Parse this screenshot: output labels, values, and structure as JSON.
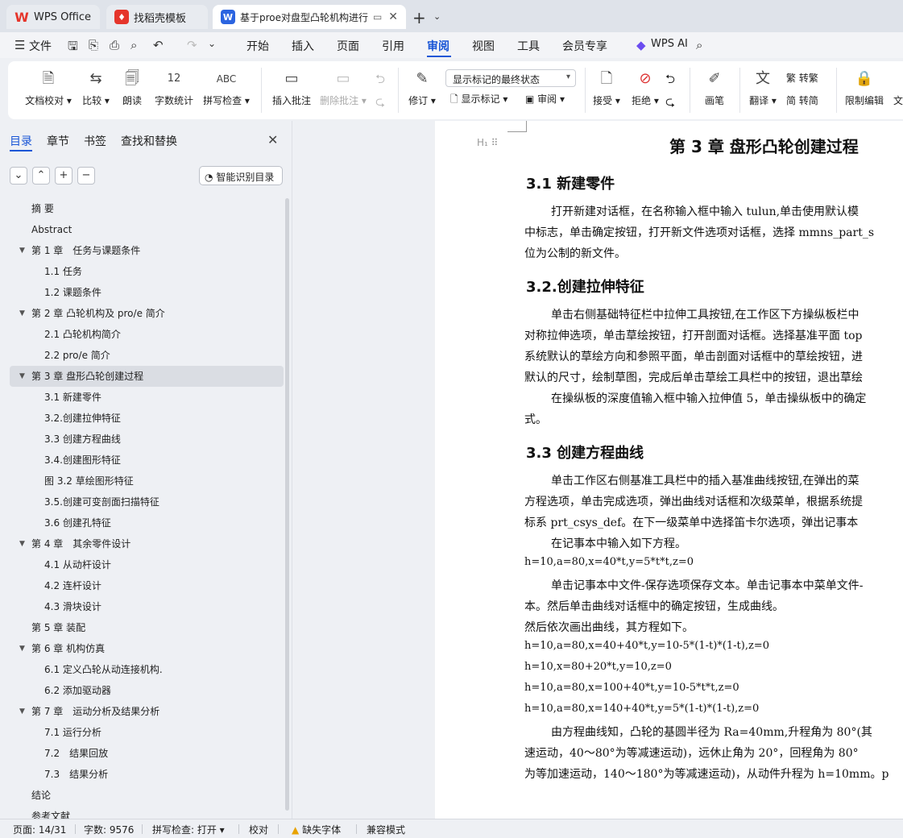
{
  "tabs": [
    {
      "label": "WPS Office"
    },
    {
      "label": "找稻壳模板"
    },
    {
      "label": "基于proe对盘型凸轮机构进行"
    }
  ],
  "menu": {
    "file": "文件",
    "items": [
      "开始",
      "插入",
      "页面",
      "引用",
      "审阅",
      "视图",
      "工具",
      "会员专享"
    ],
    "wps_ai": "WPS AI"
  },
  "ribbon": {
    "doc_proof": "文档校对",
    "compare": "比较",
    "read_aloud": "朗读",
    "word_count": "字数统计",
    "spell_check": "拼写检查",
    "insert_comment": "插入批注",
    "delete_comment": "删除批注",
    "revise": "修订",
    "markup_state": "显示标记的最终状态",
    "show_markup": "显示标记",
    "review": "审阅",
    "accept": "接受",
    "reject": "拒绝",
    "pen": "画笔",
    "translate": "翻译",
    "to_traditional": "转繁",
    "to_simplified": "转简",
    "restrict_edit": "限制编辑",
    "more": "文"
  },
  "panel": {
    "tabs": [
      "目录",
      "章节",
      "书签",
      "查找和替换"
    ],
    "smart_btn": "智能识别目录",
    "toc": [
      {
        "label": "摘 要",
        "level": 1,
        "arrow": false
      },
      {
        "label": "Abstract",
        "level": 1,
        "arrow": false
      },
      {
        "label": "第 1 章　任务与课题条件",
        "level": 1,
        "arrow": true
      },
      {
        "label": "1.1 任务",
        "level": 2,
        "arrow": false
      },
      {
        "label": "1.2 课题条件",
        "level": 2,
        "arrow": false
      },
      {
        "label": "第 2 章 凸轮机构及 pro/e 简介",
        "level": 1,
        "arrow": true
      },
      {
        "label": "2.1 凸轮机构简介",
        "level": 2,
        "arrow": false
      },
      {
        "label": "2.2 pro/e 简介",
        "level": 2,
        "arrow": false
      },
      {
        "label": "第 3 章 盘形凸轮创建过程",
        "level": 1,
        "arrow": true,
        "selected": true
      },
      {
        "label": "3.1 新建零件",
        "level": 2,
        "arrow": false
      },
      {
        "label": "3.2.创建拉伸特征",
        "level": 2,
        "arrow": false
      },
      {
        "label": "3.3 创建方程曲线",
        "level": 2,
        "arrow": false
      },
      {
        "label": "3.4.创建图形特征",
        "level": 2,
        "arrow": false
      },
      {
        "label": "图 3.2 草绘图形特征",
        "level": 2,
        "arrow": false
      },
      {
        "label": "3.5.创建可变剖面扫描特征",
        "level": 2,
        "arrow": false
      },
      {
        "label": "3.6 创建孔特征",
        "level": 2,
        "arrow": false
      },
      {
        "label": "第 4 章　其余零件设计",
        "level": 1,
        "arrow": true
      },
      {
        "label": "4.1 从动杆设计",
        "level": 2,
        "arrow": false
      },
      {
        "label": "4.2 连杆设计",
        "level": 2,
        "arrow": false
      },
      {
        "label": "4.3 滑块设计",
        "level": 2,
        "arrow": false
      },
      {
        "label": "第 5 章 装配",
        "level": 1,
        "arrow": false
      },
      {
        "label": "第 6 章 机构仿真",
        "level": 1,
        "arrow": true
      },
      {
        "label": "6.1 定义凸轮从动连接机构.",
        "level": 2,
        "arrow": false
      },
      {
        "label": "6.2 添加驱动器",
        "level": 2,
        "arrow": false
      },
      {
        "label": "第 7 章　运动分析及结果分析",
        "level": 1,
        "arrow": true
      },
      {
        "label": "7.1 运行分析",
        "level": 2,
        "arrow": false
      },
      {
        "label": "7.2　结果回放",
        "level": 2,
        "arrow": false
      },
      {
        "label": "7.3　结果分析",
        "level": 2,
        "arrow": false
      },
      {
        "label": "结论",
        "level": 1,
        "arrow": false
      },
      {
        "label": "参考文献",
        "level": 1,
        "arrow": false
      }
    ]
  },
  "doc": {
    "heading_marker": "H₁",
    "chapter_title": "第 3 章  盘形凸轮创建过程",
    "lines": [
      {
        "kind": "h2",
        "text": "3.1  新建零件"
      },
      {
        "kind": "ind",
        "text": "打开新建对话框，在名称输入框中输入 tulun,单击使用默认模"
      },
      {
        "kind": "p",
        "text": "中标志，单击确定按钮，打开新文件选项对话框，选择 mmns_part_s"
      },
      {
        "kind": "p",
        "text": "位为公制的新文件。"
      },
      {
        "kind": "h2",
        "text": "3.2.创建拉伸特征"
      },
      {
        "kind": "ind",
        "text": "单击右侧基础特征栏中拉伸工具按钮,在工作区下方操纵板栏中"
      },
      {
        "kind": "p",
        "text": "对称拉伸选项，单击草绘按钮，打开剖面对话框。选择基准平面 top"
      },
      {
        "kind": "p",
        "text": "系统默认的草绘方向和参照平面，单击剖面对话框中的草绘按钮，进"
      },
      {
        "kind": "p",
        "text": "默认的尺寸，绘制草图，完成后单击草绘工具栏中的按钮，退出草绘"
      },
      {
        "kind": "ind",
        "text": "在操纵板的深度值输入框中输入拉伸值 5，单击操纵板中的确定"
      },
      {
        "kind": "p",
        "text": "式。"
      },
      {
        "kind": "h2",
        "text": "3.3  创建方程曲线"
      },
      {
        "kind": "ind",
        "text": "单击工作区右侧基准工具栏中的插入基准曲线按钮,在弹出的菜"
      },
      {
        "kind": "p",
        "text": "方程选项，单击完成选项，弹出曲线对话框和次级菜单，根据系统提"
      },
      {
        "kind": "p",
        "text": "标系 prt_csys_def。在下一级菜单中选择笛卡尔选项，弹出记事本"
      },
      {
        "kind": "ind",
        "text": "在记事本中输入如下方程。"
      },
      {
        "kind": "small",
        "text": "h=10,a=80,x=40*t,y=5*t*t,z=0"
      },
      {
        "kind": "ind",
        "text": "单击记事本中文件-保存选项保存文本。单击记事本中菜单文件-"
      },
      {
        "kind": "p",
        "text": "本。然后单击曲线对话框中的确定按钮，生成曲线。"
      },
      {
        "kind": "p",
        "text": "然后依次画出曲线，其方程如下。"
      },
      {
        "kind": "small",
        "text": "h=10,a=80,x=40+40*t,y=10-5*(1-t)*(1-t),z=0"
      },
      {
        "kind": "small",
        "text": "h=10,x=80+20*t,y=10,z=0"
      },
      {
        "kind": "small",
        "text": "h=10,a=80,x=100+40*t,y=10-5*t*t,z=0"
      },
      {
        "kind": "small",
        "text": "h=10,a=80,x=140+40*t,y=5*(1-t)*(1-t),z=0"
      },
      {
        "kind": "ind",
        "text": "由方程曲线知，凸轮的基圆半径为 Ra=40mm,升程角为 80°(其"
      },
      {
        "kind": "p",
        "text": "速运动，40～80°为等减速运动)，远休止角为 20°，回程角为 80°"
      },
      {
        "kind": "p",
        "text": "为等加速运动，140～180°为等减速运动)，从动件升程为 h=10mm。p"
      }
    ]
  },
  "status": {
    "page": "页面: 14/31",
    "words": "字数: 9576",
    "spell": "拼写检查: 打开",
    "proof": "校对",
    "missing_font": "缺失字体",
    "compat": "兼容模式"
  },
  "colors": {
    "accent": "#1a56d6",
    "wps_red": "#e5352b"
  }
}
